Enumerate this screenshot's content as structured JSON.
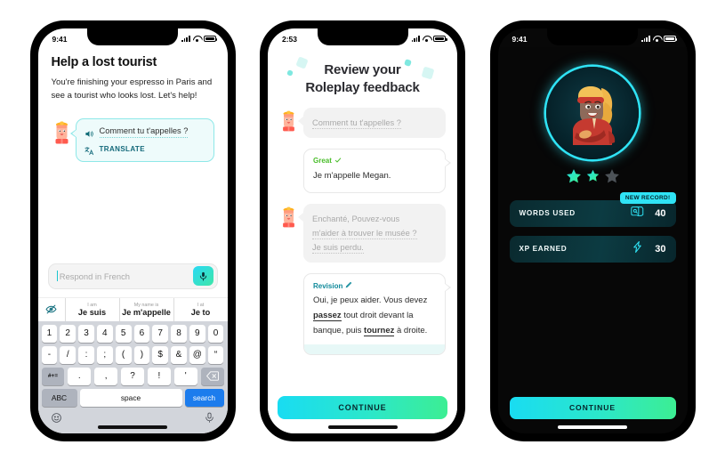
{
  "phone1": {
    "status": {
      "time": "9:41"
    },
    "title": "Help a lost tourist",
    "description": "You're finishing your espresso in Paris and see a tourist who looks lost. Let's help!",
    "bubble": {
      "phrase": "Comment tu t'appelles ?",
      "translate_label": "TRANSLATE",
      "speaker_icon": "speaker-icon",
      "translate_icon": "translate-icon"
    },
    "input": {
      "placeholder": "Respond in French",
      "mic_icon": "microphone-icon"
    },
    "suggestions": {
      "eye_icon": "hide-hints-icon",
      "items": [
        {
          "hint": "I am",
          "word": "Je suis"
        },
        {
          "hint": "My name is",
          "word": "Je m'appelle"
        },
        {
          "hint": "I at",
          "word": "Je to"
        }
      ]
    },
    "keyboard": {
      "row1": [
        "1",
        "2",
        "3",
        "4",
        "5",
        "6",
        "7",
        "8",
        "9",
        "0"
      ],
      "row2": [
        "-",
        "/",
        ":",
        ";",
        "(",
        ")",
        "$",
        "&",
        "@",
        "“"
      ],
      "row3_sym": "#+=",
      "row3": [
        ".",
        ",",
        "?",
        "!",
        "'"
      ],
      "row3_backspace": "backspace-icon",
      "row4_abc": "ABC",
      "row4_space": "space",
      "row4_search": "search",
      "emoji_icon": "emoji-icon",
      "dictate_icon": "dictation-icon"
    }
  },
  "phone2": {
    "status": {
      "time": "2:53"
    },
    "title_line1": "Review your",
    "title_line2": "Roleplay feedback",
    "messages": [
      {
        "type": "prompt-gray",
        "side": "left",
        "text": "Comment tu t'appelles ?"
      },
      {
        "type": "feedback",
        "side": "right",
        "header": "Great",
        "header_icon": "checkmark-icon",
        "body": "Je m'appelle Megan."
      },
      {
        "type": "prompt-gray",
        "side": "left",
        "line1": "Enchanté, Pouvez-vous",
        "line2": "m'aider à trouver le musée ?",
        "line3": "Je suis perdu."
      },
      {
        "type": "revision",
        "side": "right",
        "header": "Revision",
        "header_icon": "pencil-icon",
        "body_parts": [
          "Oui, je peux aider. Vous devez ",
          "passez",
          " tout droit devant la banque, puis ",
          "tournez",
          " à droite."
        ]
      }
    ],
    "cta": "CONTINUE"
  },
  "phone3": {
    "status": {
      "time": "9:41"
    },
    "avatar_icon": "character-avatar",
    "stars": {
      "filled": 2,
      "total": 3
    },
    "badge": "NEW RECORD!",
    "stats": [
      {
        "label": "WORDS USED",
        "icon": "word-cards-icon",
        "value": "40"
      },
      {
        "label": "XP EARNED",
        "icon": "xp-bolt-icon",
        "value": "30"
      }
    ],
    "cta": "CONTINUE"
  },
  "colors": {
    "accent_cyan": "#2fe3f5",
    "accent_green": "#3cee93",
    "teal_bubble_bg": "#eefbfb",
    "teal_bubble_border": "#8ee8e8",
    "great_green": "#49bd2a",
    "revision_teal": "#108a9b",
    "keyboard_bg": "#d2d5db",
    "search_blue": "#1c7ced"
  }
}
